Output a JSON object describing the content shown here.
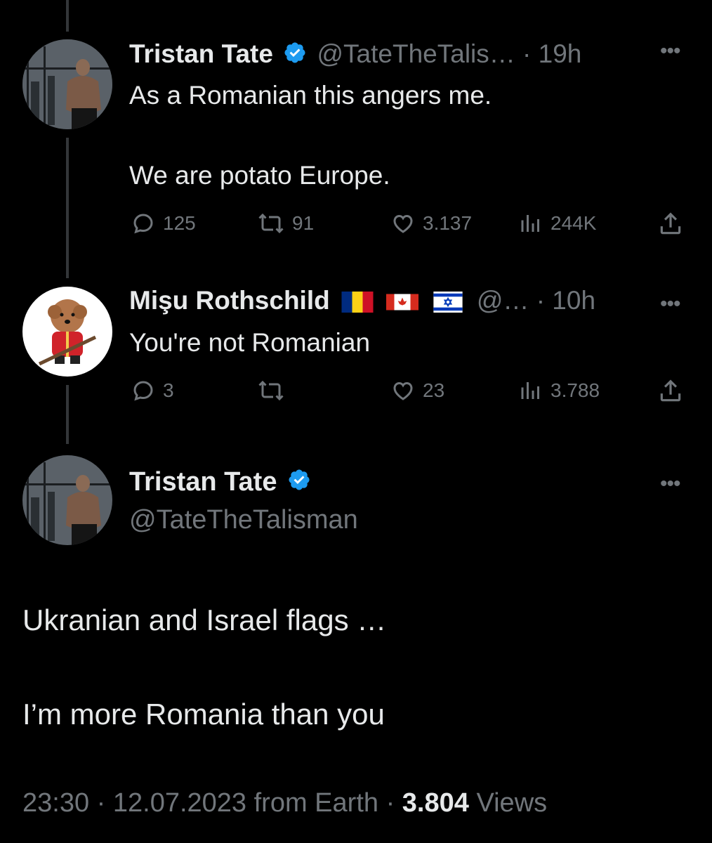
{
  "tweet1": {
    "author_name": "Tristan Tate",
    "handle_time": "@TateTheTalis… · 19h",
    "text_line1": "As a Romanian this angers me.",
    "text_line2": "We are potato Europe.",
    "replies": "125",
    "retweets": "91",
    "likes": "3.137",
    "views": "244K"
  },
  "tweet2": {
    "author_name": "Mişu Rothschild",
    "flags": [
      "Romania",
      "Canada",
      "Israel"
    ],
    "handle_time": "@… · 10h",
    "text": "You're not Romanian",
    "replies": "3",
    "retweets": "",
    "likes": "23",
    "views": "3.788"
  },
  "tweet3": {
    "author_name": "Tristan Tate",
    "handle": "@TateTheTalisman",
    "text_line1": "Ukranian and Israel flags …",
    "text_line2": "I’m more Romania than you",
    "time": "23:30",
    "date": "12.07.2023",
    "source": "from Earth",
    "views_count": "3.804",
    "views_label": "Views"
  },
  "icons": {
    "verified": "verified-badge-icon",
    "more": "more-dots-icon",
    "reply": "reply-icon",
    "retweet": "retweet-icon",
    "like": "like-icon",
    "views": "views-icon",
    "share": "share-icon"
  },
  "colors": {
    "background": "#000000",
    "text": "#e7e9ea",
    "muted": "#71767b",
    "verified": "#1d9bf0"
  }
}
